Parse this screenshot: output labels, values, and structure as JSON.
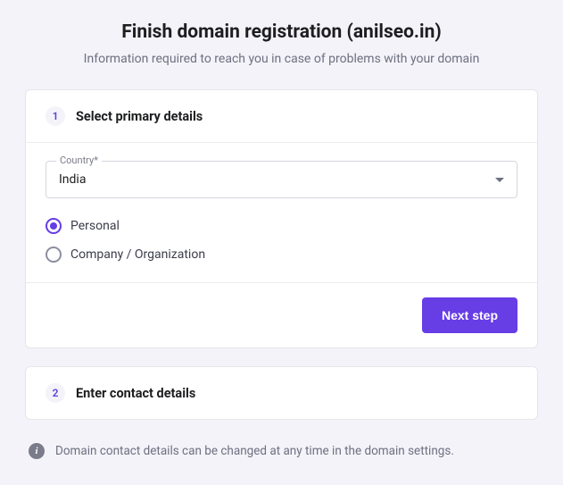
{
  "header": {
    "title": "Finish domain registration (anilseo.in)",
    "subtitle": "Information required to reach you in case of problems with your domain"
  },
  "step1": {
    "number": "1",
    "title": "Select primary details",
    "country_label": "Country*",
    "country_value": "India",
    "radio_personal": "Personal",
    "radio_company": "Company / Organization",
    "next_button": "Next step"
  },
  "step2": {
    "number": "2",
    "title": "Enter contact details"
  },
  "info": {
    "text": "Domain contact details can be changed at any time in the domain settings."
  }
}
